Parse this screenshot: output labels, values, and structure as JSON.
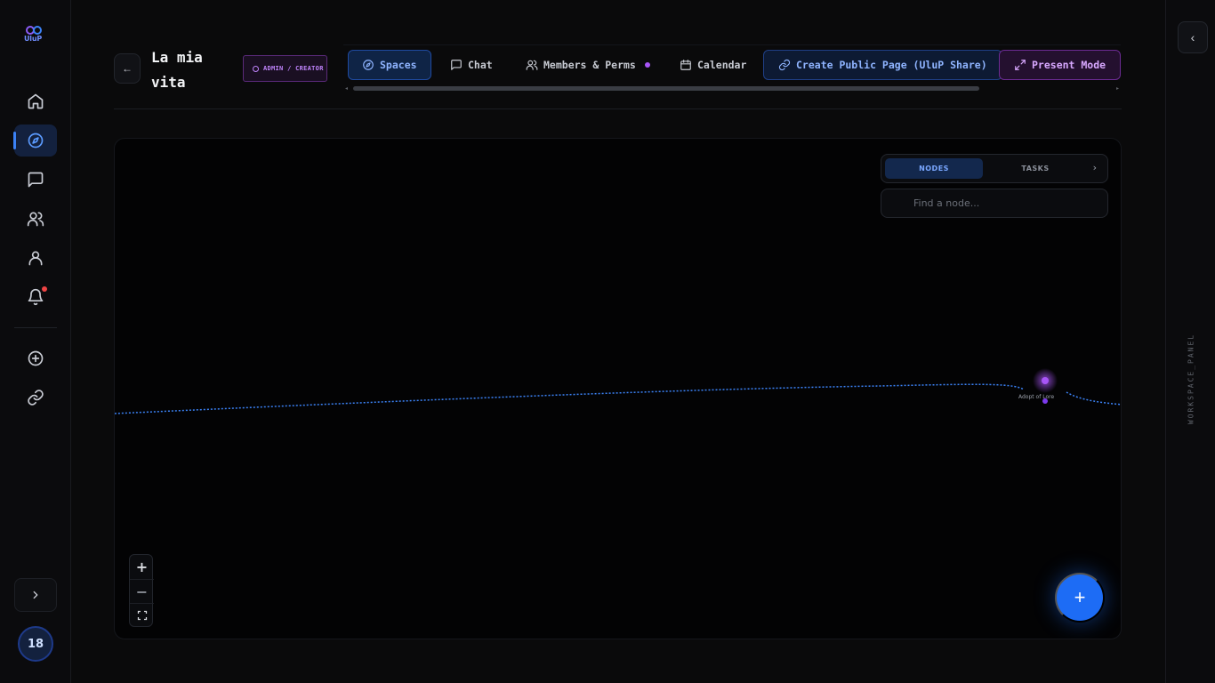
{
  "app": {
    "logo_text": "UluP"
  },
  "sidebar": {
    "items": [
      {
        "name": "home",
        "icon": "home-icon",
        "active": false
      },
      {
        "name": "explore",
        "icon": "compass-icon",
        "active": true
      },
      {
        "name": "chat",
        "icon": "chat-icon",
        "active": false
      },
      {
        "name": "groups",
        "icon": "users-icon",
        "active": false
      },
      {
        "name": "profile",
        "icon": "user-icon",
        "active": false
      },
      {
        "name": "notifications",
        "icon": "bell-icon",
        "active": false,
        "badge": true
      },
      {
        "name": "create",
        "icon": "plus-circle-icon",
        "active": false
      },
      {
        "name": "links",
        "icon": "link-icon",
        "active": false
      }
    ],
    "expand_icon": "chevron-right-icon",
    "avatar_text": "18"
  },
  "header": {
    "back_label": "←",
    "title": "La mia vita",
    "role_badge": "ADMIN / CREATOR",
    "tabs": [
      {
        "label": "Spaces",
        "icon": "compass-icon",
        "active": true
      },
      {
        "label": "Chat",
        "icon": "chat-icon",
        "active": false
      },
      {
        "label": "Members & Perms",
        "icon": "users-icon",
        "active": false,
        "dot": true
      },
      {
        "label": "Calendar",
        "icon": "calendar-icon",
        "active": false
      },
      {
        "label": "Create Public Page (UluP Share)",
        "icon": "link-icon",
        "active": false
      },
      {
        "label": "Present Mode",
        "icon": "expand-icon",
        "active": false
      }
    ]
  },
  "canvas": {
    "panel_tabs": [
      {
        "label": "NODES",
        "active": true
      },
      {
        "label": "TASKS",
        "active": false
      }
    ],
    "panel_chevron": "›",
    "search": {
      "placeholder": "Find a node..."
    },
    "zoom": {
      "in": "+",
      "out": "−",
      "fit": "⛶"
    },
    "fab_label": "+",
    "node": {
      "label": "Adopt of Lore",
      "color": "#a855f7"
    },
    "edge_color": "#3b82f6"
  },
  "right_panel": {
    "toggle": "‹",
    "label": "WORKSPACE_PANEL"
  },
  "colors": {
    "accent": "#3b82f6",
    "purple": "#a855f7",
    "background": "#0a0a0b"
  }
}
